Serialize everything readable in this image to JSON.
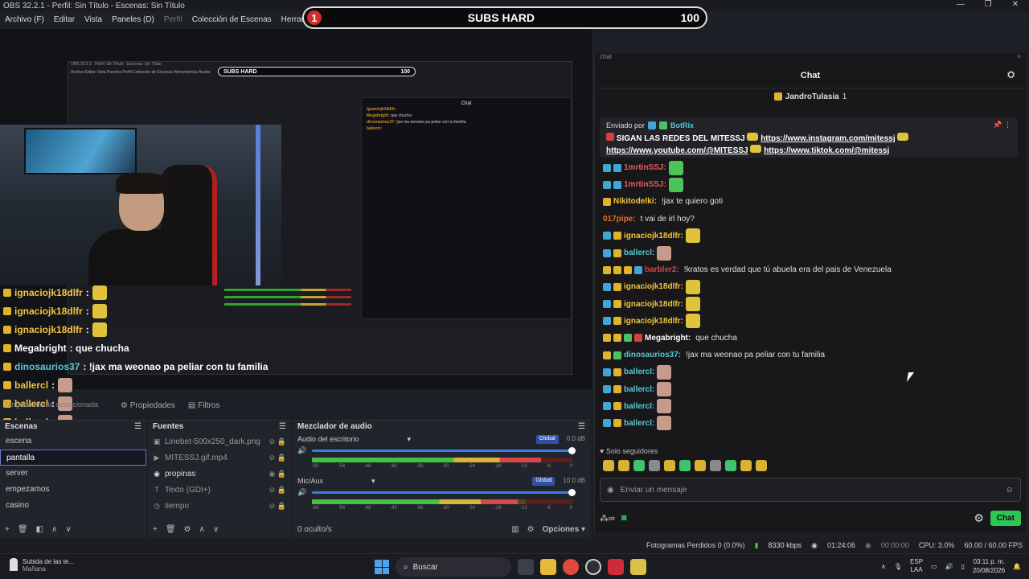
{
  "window": {
    "title": "OBS 32.2.1 - Perfil: Sin Título - Escenas: Sin Título",
    "controls": [
      "—",
      "❐",
      "✕"
    ]
  },
  "menu": [
    {
      "label": "Archivo (F)",
      "dim": false
    },
    {
      "label": "Editar",
      "dim": false
    },
    {
      "label": "Vista",
      "dim": false
    },
    {
      "label": "Paneles (D)",
      "dim": false
    },
    {
      "label": "Perfil",
      "dim": true
    },
    {
      "label": "Colección de Escenas",
      "dim": false
    },
    {
      "label": "Herramientas",
      "dim": false
    },
    {
      "label": "Ayuda (H)",
      "dim": false
    }
  ],
  "subs_banner": {
    "badge": "1",
    "label": "SUBS HARD",
    "count": "100"
  },
  "nested_preview": {
    "title": "OBS 32.2.1 - Perfil: Sin Título - Escenas: Sin Título",
    "menu": "Archivo  Editar  Vista  Paneles  Perfil  Colección de Escenas  Herramientas  Ayuda",
    "subs_label": "SUBS HARD",
    "subs_count": "100",
    "chat_header": "Chat",
    "chat_lines": [
      {
        "user": "ignaciojk18dlfr:",
        "text": ""
      },
      {
        "user": "Megabright:",
        "text": "que chucha"
      },
      {
        "user": "dinosaurios37:",
        "text": "!jax ma weonao pa peliar con tu familia"
      },
      {
        "user": "ballercl:",
        "text": ""
      }
    ]
  },
  "overlay_chat": [
    {
      "user": "ignaciojk18dlfr",
      "text": ":",
      "color": "nm"
    },
    {
      "user": "ignaciojk18dlfr",
      "text": ":",
      "color": "nm"
    },
    {
      "user": "ignaciojk18dlfr",
      "text": ":",
      "color": "nm"
    },
    {
      "user": "Megabright",
      "text": ": que chucha",
      "color": "wh"
    },
    {
      "user": "dinosaurios37",
      "text": ": !jax ma weonao pa peliar con tu familia",
      "color": "cy"
    },
    {
      "user": "ballercl",
      "text": ":",
      "color": "nm"
    },
    {
      "user": "ballercl",
      "text": ":",
      "color": "nm"
    },
    {
      "user": "ballercl",
      "text": ":",
      "color": "nm"
    },
    {
      "user": "ballercl",
      "text": ":",
      "color": "nm"
    }
  ],
  "docks": {
    "no_source": "Ninguna fuente seleccionada",
    "properties": "Propiedades",
    "filters": "Filtros"
  },
  "scenes": {
    "header": "Escenas",
    "items": [
      {
        "label": "escena",
        "selected": false
      },
      {
        "label": "pantalla",
        "selected": true
      },
      {
        "label": "server",
        "selected": false
      },
      {
        "label": "empezamos",
        "selected": false
      },
      {
        "label": "casino",
        "selected": false
      }
    ]
  },
  "sources": {
    "header": "Fuentes",
    "items": [
      {
        "icon": "▣",
        "label": "Linebet-500x250_dark.png",
        "visible": false
      },
      {
        "icon": "▶",
        "label": "MITESSJ.gif.mp4",
        "visible": false
      },
      {
        "icon": "◉",
        "label": "propinas",
        "visible": true
      },
      {
        "icon": "T",
        "label": "Texto (GDI+)",
        "visible": false
      },
      {
        "icon": "◷",
        "label": "tiempo",
        "visible": false
      }
    ]
  },
  "mixer": {
    "header": "Mezclador de audio",
    "hidden": "0 oculto/s",
    "options": "Opciones",
    "ticks": [
      "-60",
      "-54",
      "-48",
      "-42",
      "-36",
      "-30",
      "-24",
      "-18",
      "-12",
      "-6",
      "0"
    ],
    "tracks": [
      {
        "name": "Audio del escritorio",
        "scope": "Global",
        "db": "0.0 dB",
        "level": 0.88
      },
      {
        "name": "Mic/Aux",
        "scope": "Global",
        "db": "10.0 dB",
        "level": 0.79
      }
    ]
  },
  "chat": {
    "dock_title": "chat",
    "header": "Chat",
    "host": "JandroTulasia",
    "host_count": "1",
    "pinned": {
      "label": "Enviado por",
      "bot": "BotRix",
      "text": "SIGAN LAS REDES DEL MITESSJ",
      "links": [
        "https://www.instagram.com/mitessj",
        "https://www.youtube.com/@MITESSJ",
        "https://www.tiktok.com/@mitessj"
      ]
    },
    "messages": [
      {
        "user": "1mrtinSSJ:",
        "text": "",
        "color": "#e85b5b",
        "badges": [
          "bl",
          "bl"
        ]
      },
      {
        "user": "1mrtinSSJ:",
        "text": "",
        "color": "#e85b5b",
        "badges": [
          "bl",
          "bl"
        ]
      },
      {
        "user": "Nikitodelki:",
        "text": "!jax te quiero goti",
        "color": "#f0c43a",
        "badges": [
          "y"
        ]
      },
      {
        "user": "017pipe:",
        "text": "t vai de irl hoy?",
        "color": "#e0702c",
        "badges": []
      },
      {
        "user": "ignaciojk18dlfr:",
        "text": "",
        "color": "#f0c43a",
        "badges": [
          "bl",
          "y"
        ]
      },
      {
        "user": "ballercl:",
        "text": "",
        "color": "#57c7d4",
        "badges": [
          "bl",
          "y"
        ]
      },
      {
        "user": "barbler2:",
        "text": "!kratos es verdad que tú abuela era del pais de Venezuela",
        "color": "#d04848",
        "badges": [
          "y",
          "y",
          "y",
          "bl"
        ]
      },
      {
        "user": "ignaciojk18dlfr:",
        "text": "",
        "color": "#f0c43a",
        "badges": [
          "bl",
          "y"
        ]
      },
      {
        "user": "ignaciojk18dlfr:",
        "text": "",
        "color": "#f0c43a",
        "badges": [
          "bl",
          "y"
        ]
      },
      {
        "user": "ignaciojk18dlfr:",
        "text": "",
        "color": "#f0c43a",
        "badges": [
          "bl",
          "y"
        ]
      },
      {
        "user": "Megabright:",
        "text": "que chucha",
        "color": "#ffffff",
        "badges": [
          "y",
          "y",
          "gr",
          "rd"
        ]
      },
      {
        "user": "dinosaurios37:",
        "text": "!jax ma weonao pa peliar con tu familia",
        "color": "#57c7d4",
        "badges": [
          "y",
          "gr"
        ]
      },
      {
        "user": "ballercl:",
        "text": "",
        "color": "#57c7d4",
        "badges": [
          "bl",
          "y"
        ]
      },
      {
        "user": "ballercl:",
        "text": "",
        "color": "#57c7d4",
        "badges": [
          "bl",
          "y"
        ]
      },
      {
        "user": "ballercl:",
        "text": "",
        "color": "#57c7d4",
        "badges": [
          "bl",
          "y"
        ]
      },
      {
        "user": "ballercl:",
        "text": "",
        "color": "#57c7d4",
        "badges": [
          "bl",
          "y"
        ]
      }
    ],
    "followers_only": "Solo seguidores",
    "input_placeholder": "Enviar un mensaje",
    "send_label": "Chat"
  },
  "status": {
    "dropped": "Fotogramas Perdidos 0 (0.0%)",
    "bitrate": "8330 kbps",
    "stream_time": "01:24:06",
    "rec_time": "00:00:00",
    "cpu": "CPU: 3.0%",
    "fps": "60.00 / 60.00 FPS"
  },
  "taskbar": {
    "weather_title": "Subida de las te...",
    "weather_sub": "Mañana",
    "search": "Buscar",
    "lang": "ESP",
    "layout": "LAA",
    "time": "03:11 p. m.",
    "date": "20/08/2026"
  },
  "colors": {
    "accent": "#2ec557",
    "obs_bg": "#22242b",
    "selection": "#6a7bd0"
  }
}
